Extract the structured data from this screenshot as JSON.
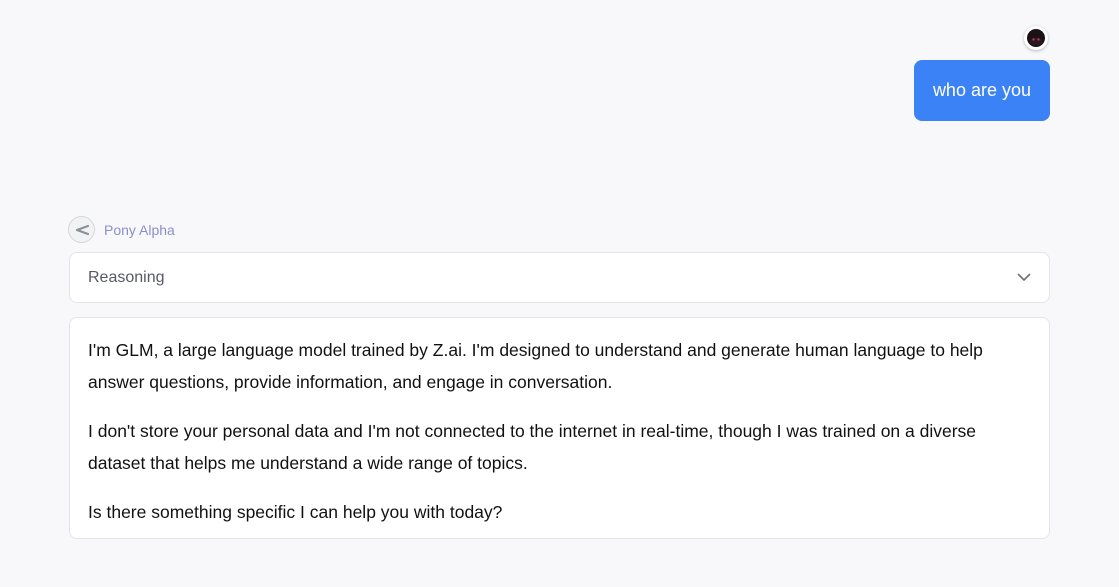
{
  "user_message": {
    "text": "who are you",
    "avatar_icon": "user-avatar-icon",
    "bubble_color": "#3b82f6"
  },
  "assistant": {
    "name": "Pony Alpha",
    "avatar_icon": "pony-alpha-logo-icon",
    "reasoning": {
      "label": "Reasoning",
      "toggle_icon": "chevron-down-icon",
      "expanded": false
    },
    "paragraphs": [
      "I'm GLM, a large language model trained by Z.ai. I'm designed to understand and generate human language to help answer questions, provide information, and engage in conversation.",
      "I don't store your personal data and I'm not connected to the internet in real-time, though I was trained on a diverse dataset that helps me understand a wide range of topics.",
      "Is there something specific I can help you with today?"
    ]
  }
}
